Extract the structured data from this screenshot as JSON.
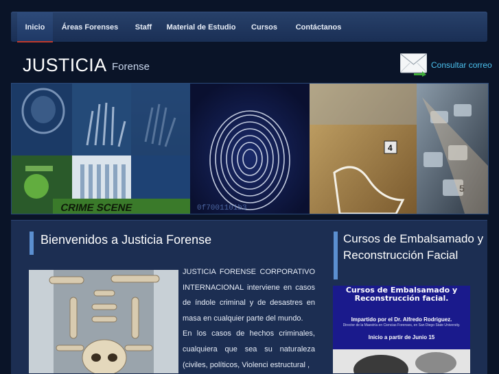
{
  "nav": {
    "items": [
      {
        "label": "Inicio",
        "active": true
      },
      {
        "label": "Áreas Forenses"
      },
      {
        "label": "Staff"
      },
      {
        "label": "Material de Estudio"
      },
      {
        "label": "Cursos"
      },
      {
        "label": "Contáctanos"
      }
    ]
  },
  "brand": {
    "title": "JUSTICIA",
    "subtitle": "Forense"
  },
  "mail": {
    "label": "Consultar correo",
    "icon": "envelope-icon"
  },
  "banner": {
    "icon": "forensic-collage-image"
  },
  "welcome": {
    "title": "Bienvenidos a Justicia Forense",
    "paragraph1": "JUSTICIA FORENSE CORPORATIVO INTERNACIONAL interviene en casos de índole criminal y de desastres en masa en cualquier parte del mundo.",
    "paragraph2": "En los casos de hechos criminales, cualquiera que sea su naturaleza (civiles, políticos, Violenci estructural ,"
  },
  "sidebar": {
    "title": "Cursos de Embalsamado y Reconstrucción Facial",
    "ad": {
      "title_line1": "Cursos de Embalsamado y",
      "title_line2": "Reconstrucción facial.",
      "by": "Impartido por el Dr. Alfredo Rodriguez.",
      "detail": "Director de la Maestría en Ciencias Forenses, en San Diego State University.",
      "date": "Inicio a partir de Junio 15"
    }
  },
  "colors": {
    "background": "#0a1428",
    "nav": "#1f3966",
    "accent": "#5b8fd0",
    "link": "#4cc3f0",
    "content_panel": "#1c2e52",
    "ad_background": "#1a1a8c"
  }
}
